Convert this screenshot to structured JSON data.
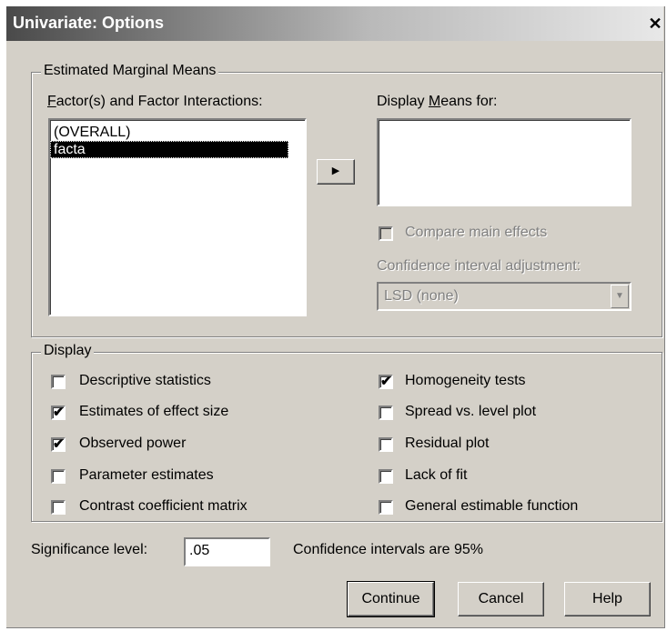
{
  "window": {
    "title": "Univariate: Options",
    "close_glyph": "✕"
  },
  "emm": {
    "group_label": "Estimated Marginal Means",
    "factors_label": "Factor(s) and Factor Interactions:",
    "factors_items": [
      "(OVERALL)",
      "facta"
    ],
    "selected_index": 1,
    "move_button_glyph": "▶",
    "display_means_label": "Display Means for:",
    "compare_main_effects": {
      "label": "Compare main effects",
      "checked": false,
      "enabled": false
    },
    "ci_adjustment_label": "Confidence interval adjustment:",
    "ci_adjustment_value": "LSD (none)",
    "dropdown_glyph": "▼"
  },
  "display": {
    "group_label": "Display",
    "left_options": [
      {
        "label": "Descriptive statistics",
        "checked": false
      },
      {
        "label": "Estimates of effect size",
        "checked": true
      },
      {
        "label": "Observed power",
        "checked": true
      },
      {
        "label": "Parameter estimates",
        "checked": false
      },
      {
        "label": "Contrast coefficient matrix",
        "checked": false
      }
    ],
    "right_options": [
      {
        "label": "Homogeneity tests",
        "checked": true
      },
      {
        "label": "Spread vs. level plot",
        "checked": false
      },
      {
        "label": "Residual plot",
        "checked": false
      },
      {
        "label": "Lack of fit",
        "checked": false
      },
      {
        "label": "General estimable function",
        "checked": false
      }
    ],
    "check_glyph": "✔"
  },
  "significance": {
    "label": "Significance level:",
    "value": ".05",
    "ci_text": "Confidence intervals are 95%"
  },
  "buttons": {
    "continue": "Continue",
    "cancel": "Cancel",
    "help": "Help"
  }
}
